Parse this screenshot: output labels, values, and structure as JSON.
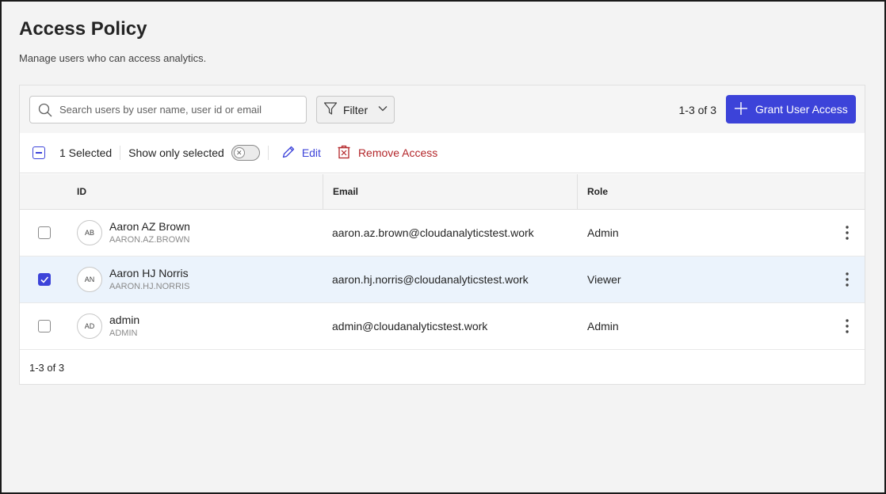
{
  "page": {
    "title": "Access Policy",
    "subtitle": "Manage users who can access analytics."
  },
  "toolbar": {
    "search_placeholder": "Search users by user name, user id or email",
    "filter_label": "Filter",
    "count_label": "1-3 of 3",
    "grant_label": "Grant User Access",
    "accent_color": "#3c43d9"
  },
  "selection_bar": {
    "selected_label": "1 Selected",
    "show_only_selected_label": "Show only selected",
    "show_only_selected_on": false,
    "edit_label": "Edit",
    "remove_label": "Remove Access"
  },
  "table": {
    "columns": [
      "ID",
      "Email",
      "Role"
    ],
    "rows": [
      {
        "initials": "AB",
        "name": "Aaron AZ Brown",
        "user_id": "AARON.AZ.BROWN",
        "email": "aaron.az.brown@cloudanalyticstest.work",
        "role": "Admin",
        "selected": false
      },
      {
        "initials": "AN",
        "name": "Aaron HJ Norris",
        "user_id": "AARON.HJ.NORRIS",
        "email": "aaron.hj.norris@cloudanalyticstest.work",
        "role": "Viewer",
        "selected": true
      },
      {
        "initials": "AD",
        "name": "admin",
        "user_id": "ADMIN",
        "email": "admin@cloudanalyticstest.work",
        "role": "Admin",
        "selected": false
      }
    ]
  },
  "footer": {
    "count_label": "1-3 of 3"
  }
}
